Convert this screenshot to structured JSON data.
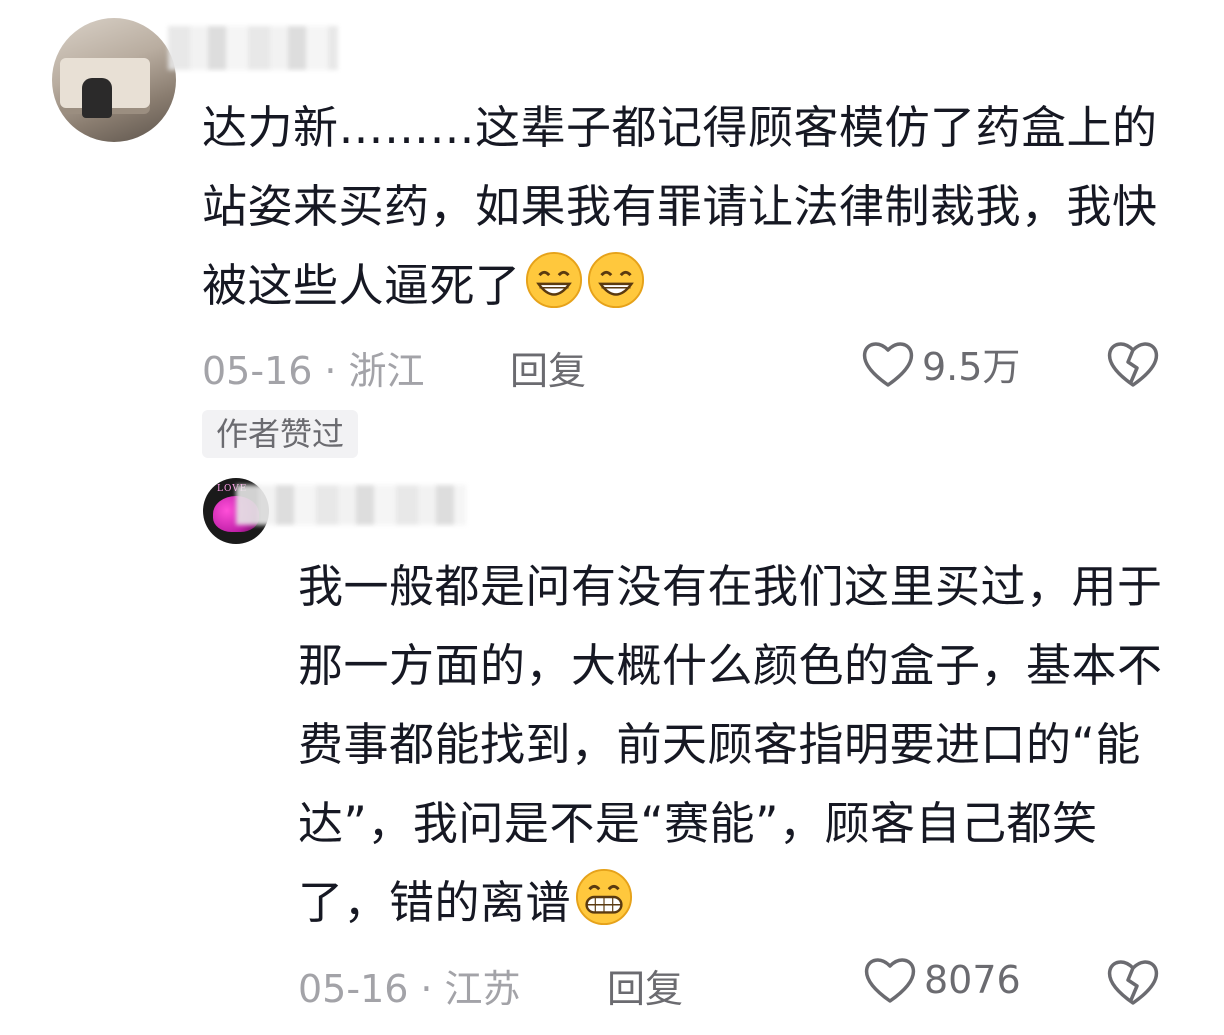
{
  "comments": [
    {
      "avatar": "bedroom-photo",
      "text": "达力新………这辈子都记得顾客模仿了药盒上的站姿来买药，如果我有罪请让法律制裁我，我快被这些人逼死了",
      "emojis": [
        "grin-emoji",
        "grin-emoji"
      ],
      "date": "05-16",
      "separator": "·",
      "location": "浙江",
      "reply_label": "回复",
      "likes": "9.5万",
      "badge": "作者赞过"
    },
    {
      "avatar": "love-heart",
      "avatar_text": "LOVE",
      "text": "我一般都是问有没有在我们这里买过，用于那一方面的，大概什么颜色的盒子，基本不费事都能找到，前天顾客指明要进口的“能达”，我问是不是“赛能”，顾客自己都笑了，错的离谱",
      "emojis": [
        "big-grin-emoji"
      ],
      "date": "05-16",
      "separator": "·",
      "location": "江苏",
      "reply_label": "回复",
      "likes": "8076"
    }
  ],
  "colors": {
    "text": "#161823",
    "meta": "#a3a3a8",
    "action": "#6b6b70",
    "badge_bg": "#f2f2f4",
    "emoji_face": "#ffc83d"
  },
  "icons": {
    "like": "heart-outline-icon",
    "dislike": "broken-heart-icon"
  }
}
